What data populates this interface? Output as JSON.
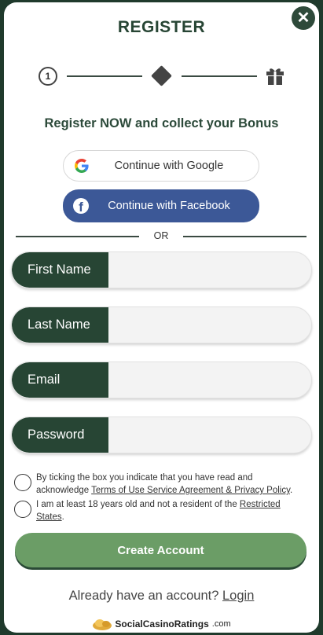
{
  "header": {
    "title": "REGISTER",
    "close_glyph": "✕"
  },
  "stepper": {
    "step_one_number": "1",
    "step_two_icon": "diamond-icon",
    "step_three_icon": "gift-icon"
  },
  "subtitle": "Register NOW and collect your Bonus",
  "social": {
    "google_label": "Continue with Google",
    "facebook_label": "Continue with Facebook",
    "facebook_glyph": "f"
  },
  "divider": {
    "or_label": "OR"
  },
  "fields": {
    "first_name": {
      "label": "First Name",
      "value": ""
    },
    "last_name": {
      "label": "Last Name",
      "value": ""
    },
    "email": {
      "label": "Email",
      "value": ""
    },
    "password": {
      "label": "Password",
      "value": ""
    }
  },
  "consent": {
    "terms_prefix": "By ticking the box you indicate that you have read and acknowledge ",
    "terms_link": "Terms of Use Service Agreement & Privacy Policy",
    "terms_suffix": ".",
    "age_prefix": "I am at least 18 years old and not a resident of the ",
    "age_link": "Restricted States",
    "age_suffix": "."
  },
  "create_account_label": "Create Account",
  "login": {
    "prompt": "Already have an account? ",
    "link": "Login"
  },
  "footer": {
    "brand": "SocialCasinoRatings",
    "tld": ".com"
  },
  "colors": {
    "primary_dark_green": "#274534",
    "button_green": "#6b9d66",
    "facebook_blue": "#3c5897"
  }
}
